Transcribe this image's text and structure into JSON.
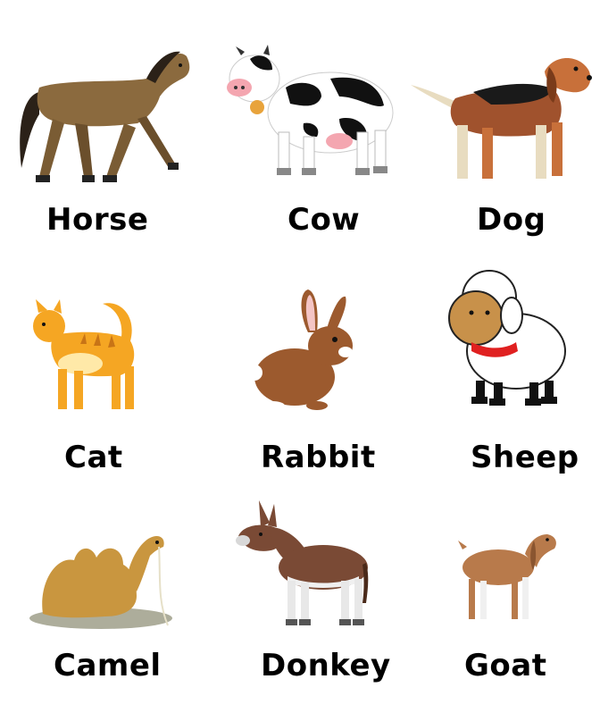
{
  "animals": [
    {
      "label": "Horse",
      "icon": "horse-icon"
    },
    {
      "label": "Cow",
      "icon": "cow-icon"
    },
    {
      "label": "Dog",
      "icon": "dog-icon"
    },
    {
      "label": "Cat",
      "icon": "cat-icon"
    },
    {
      "label": "Rabbit",
      "icon": "rabbit-icon"
    },
    {
      "label": "Sheep",
      "icon": "sheep-icon"
    },
    {
      "label": "Camel",
      "icon": "camel-icon"
    },
    {
      "label": "Donkey",
      "icon": "donkey-icon"
    },
    {
      "label": "Goat",
      "icon": "goat-icon"
    }
  ],
  "colors": {
    "horse": "#8B6A3E",
    "cow_black": "#111111",
    "cow_white": "#ffffff",
    "dog_brown": "#A0522D",
    "cat_orange": "#F5A623",
    "rabbit_brown": "#9C5A2E",
    "sheep_face": "#C8914A",
    "sheep_wool": "#ffffff",
    "camel": "#C9963F",
    "donkey": "#7A4A35",
    "goat": "#B87A4B",
    "text": "#000000"
  }
}
